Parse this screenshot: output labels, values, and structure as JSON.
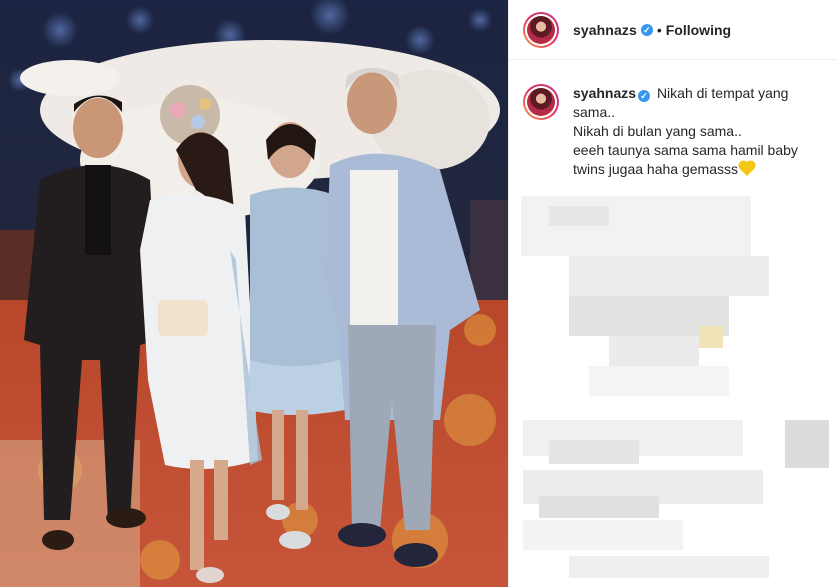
{
  "post": {
    "username": "syahnazs",
    "follow_state": "Following",
    "separator": "•",
    "verified_mark": "✓",
    "caption_lines": [
      "Nikah di tempat yang",
      "sama..",
      "Nikah di bulan yang sama..",
      "eeeh taunya sama sama hamil baby",
      "twins jugaa haha gemasss"
    ],
    "caption_emoji": "yellow-heart-icon"
  },
  "colors": {
    "verified_blue": "#3897f0",
    "border": "#efefef",
    "text": "#262626"
  }
}
